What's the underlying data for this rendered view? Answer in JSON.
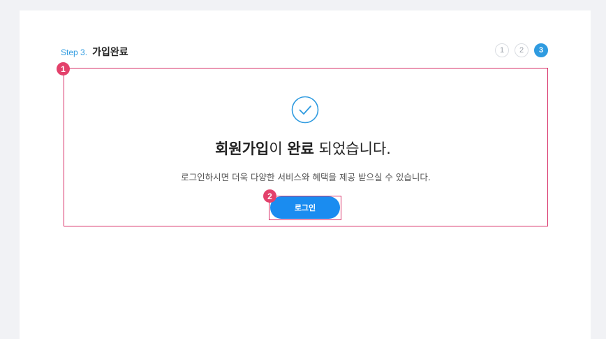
{
  "step": {
    "label": "Step 3.",
    "title": "가입완료"
  },
  "steps": [
    "1",
    "2",
    "3"
  ],
  "active_step": "3",
  "markers": [
    "1",
    "2"
  ],
  "headline": {
    "part1": "회원가입",
    "part2": "이 ",
    "part3": "완료",
    "part4": " 되었습니다."
  },
  "subtext": "로그인하시면 더욱 다양한 서비스와 혜택을 제공 받으실 수 있습니다.",
  "login_button": "로그인",
  "icons": {
    "check": "check-circle-icon"
  },
  "colors": {
    "accent": "#2f9be0",
    "button": "#1a8cf0",
    "annotation": "#d8326a"
  }
}
